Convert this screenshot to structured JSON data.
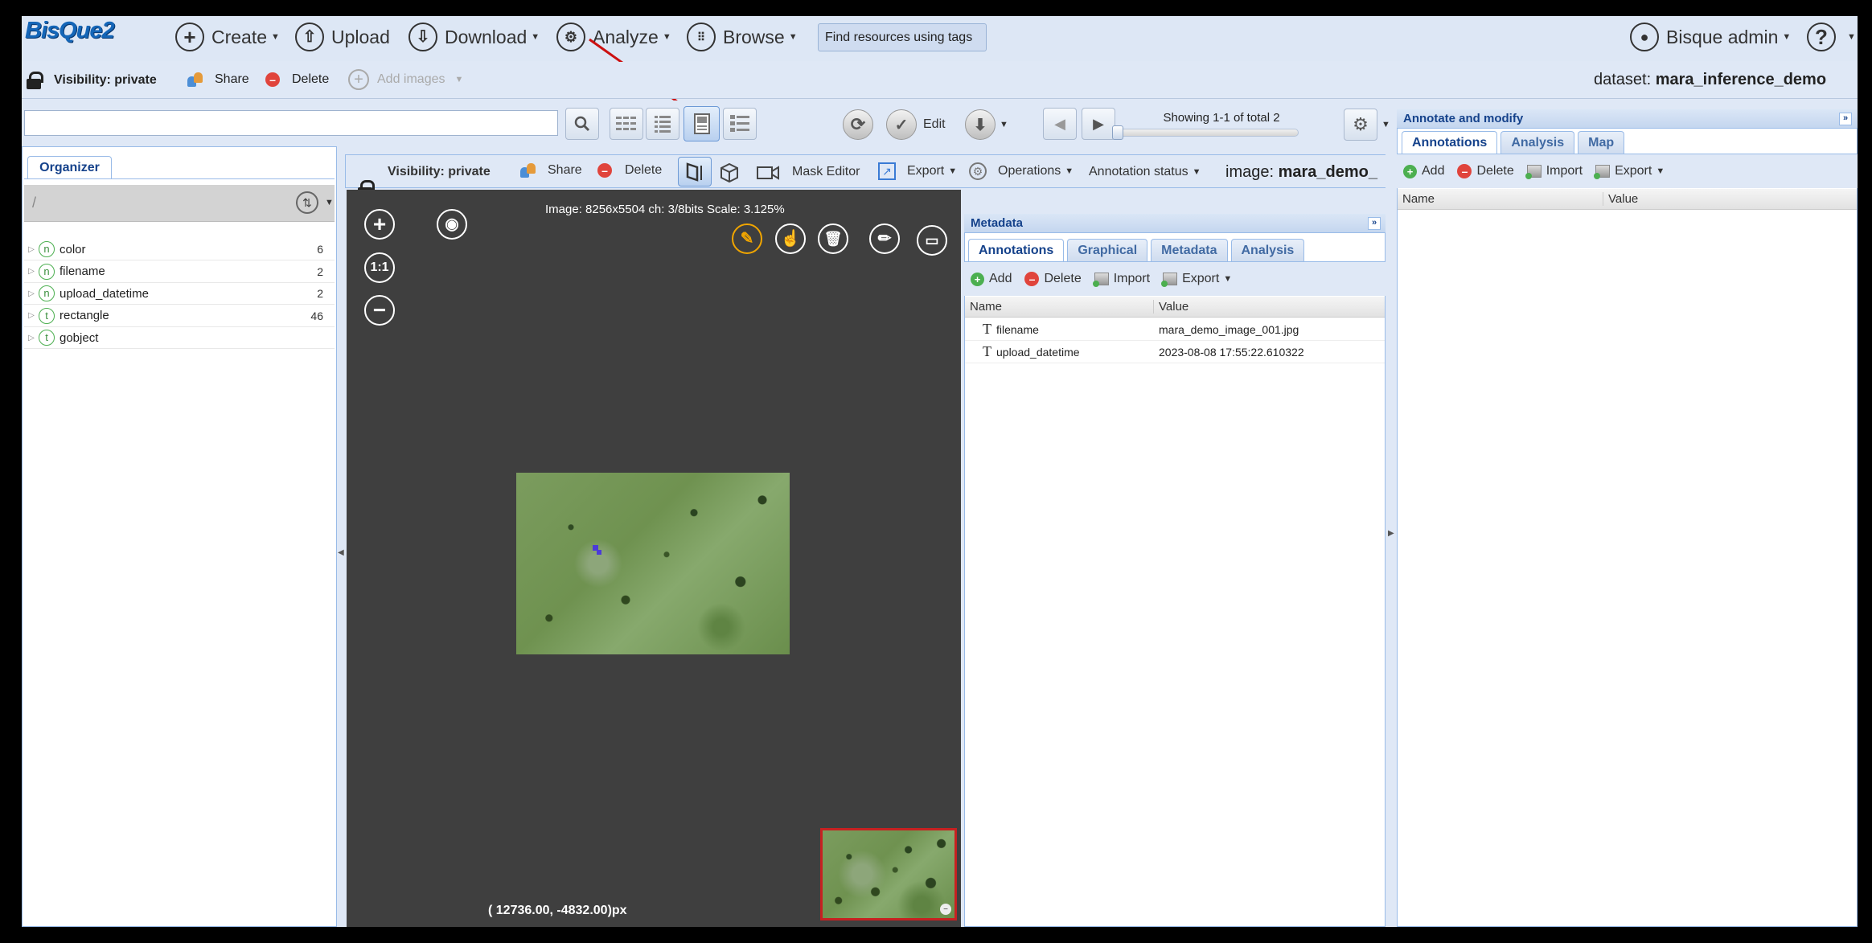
{
  "brand": {
    "logo": "BisQue2"
  },
  "topnav": {
    "create": "Create",
    "upload": "Upload",
    "download": "Download",
    "analyze": "Analyze",
    "browse": "Browse",
    "tag_search": "Find resources using tags",
    "user": "Bisque admin",
    "help": "?"
  },
  "dataset_bar": {
    "visibility": "Visibility: private",
    "share": "Share",
    "delete": "Delete",
    "add_images": "Add images",
    "dataset_prefix": "dataset:",
    "dataset_name": "mara_inference_demo"
  },
  "browser_toolbar": {
    "search_value": "",
    "edit": "Edit",
    "paging": "Showing 1-1 of total 2",
    "active_view": "document-view"
  },
  "organizer": {
    "tab": "Organizer",
    "path": "/",
    "items": [
      {
        "type": "n",
        "label": "color",
        "count": "6"
      },
      {
        "type": "n",
        "label": "filename",
        "count": "2"
      },
      {
        "type": "n",
        "label": "upload_datetime",
        "count": "2"
      },
      {
        "type": "t",
        "label": "rectangle",
        "count": "46"
      },
      {
        "type": "t",
        "label": "gobject",
        "count": ""
      }
    ]
  },
  "viewer": {
    "visibility": "Visibility: private",
    "share": "Share",
    "delete": "Delete",
    "mask_editor": "Mask Editor",
    "export": "Export",
    "operations": "Operations",
    "annotation_status": "Annotation status",
    "image_prefix": "image:",
    "image_name": "mara_demo_",
    "image_info": "Image: 8256x5504 ch: 3/8bits Scale: 3.125%",
    "zoom_one": "1:1",
    "coordinates": "( 12736.00, -4832.00)px"
  },
  "metadata": {
    "title": "Metadata",
    "tabs": [
      "Annotations",
      "Graphical",
      "Metadata",
      "Analysis"
    ],
    "add": "Add",
    "delete": "Delete",
    "import": "Import",
    "export": "Export",
    "col_name": "Name",
    "col_value": "Value",
    "rows": [
      {
        "name": "filename",
        "value": "mara_demo_image_001.jpg"
      },
      {
        "name": "upload_datetime",
        "value": "2023-08-08 17:55:22.610322"
      }
    ]
  },
  "annotate": {
    "title": "Annotate and modify",
    "tabs": [
      "Annotations",
      "Analysis",
      "Map"
    ],
    "add": "Add",
    "delete": "Delete",
    "import": "Import",
    "export": "Export",
    "col_name": "Name",
    "col_value": "Value"
  },
  "colors": {
    "accent": "#15428b",
    "panel": "#dfe8f6",
    "border": "#99bbe8",
    "viewer_bg": "#3f3f3f",
    "highlight": "#f0a500",
    "annotation_arrow": "#cc1111"
  }
}
